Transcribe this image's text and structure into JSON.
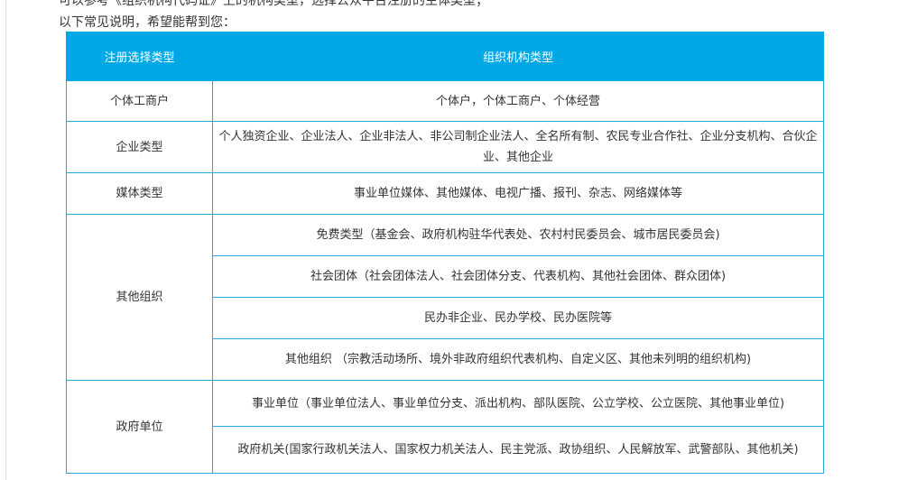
{
  "intro": {
    "line1": "可以参考《组织机构代码证》上的机构类型，选择公众平台注册的主体类型；",
    "line2": "以下常见说明，希望能帮到您："
  },
  "table": {
    "headers": [
      "注册选择类型",
      "组织机构类型"
    ],
    "groups": [
      {
        "type": "个体工商户",
        "rows": [
          "个体户，个体工商户、个体经营"
        ]
      },
      {
        "type": "企业类型",
        "rows": [
          "个人独资企业、企业法人、企业非法人、非公司制企业法人、全名所有制、农民专业合作社、企业分支机构、合伙企业、其他企业"
        ]
      },
      {
        "type": "媒体类型",
        "rows": [
          "事业单位媒体、其他媒体、电视广播、报刊、杂志、网络媒体等"
        ]
      },
      {
        "type": "其他组织",
        "rows": [
          "免费类型（基金会、政府机构驻华代表处、农村村民委员会、城市居民委员会)",
          "社会团体（社会团体法人、社会团体分支、代表机构、其他社会团体、群众团体)",
          "民办非企业、民办学校、民办医院等",
          "其他组织 （宗教活动场所、境外非政府组织代表机构、自定义区、其他未列明的组织机构)"
        ]
      },
      {
        "type": "政府单位",
        "rows": [
          "事业单位（事业单位法人、事业单位分支、派出机构、部队医院、公立学校、公立医院、其他事业单位)",
          "政府机关(国家行政机关法人、国家权力机关法人、民主党派、政协组织、人民解放军、武警部队、其他机关)"
        ]
      }
    ]
  }
}
